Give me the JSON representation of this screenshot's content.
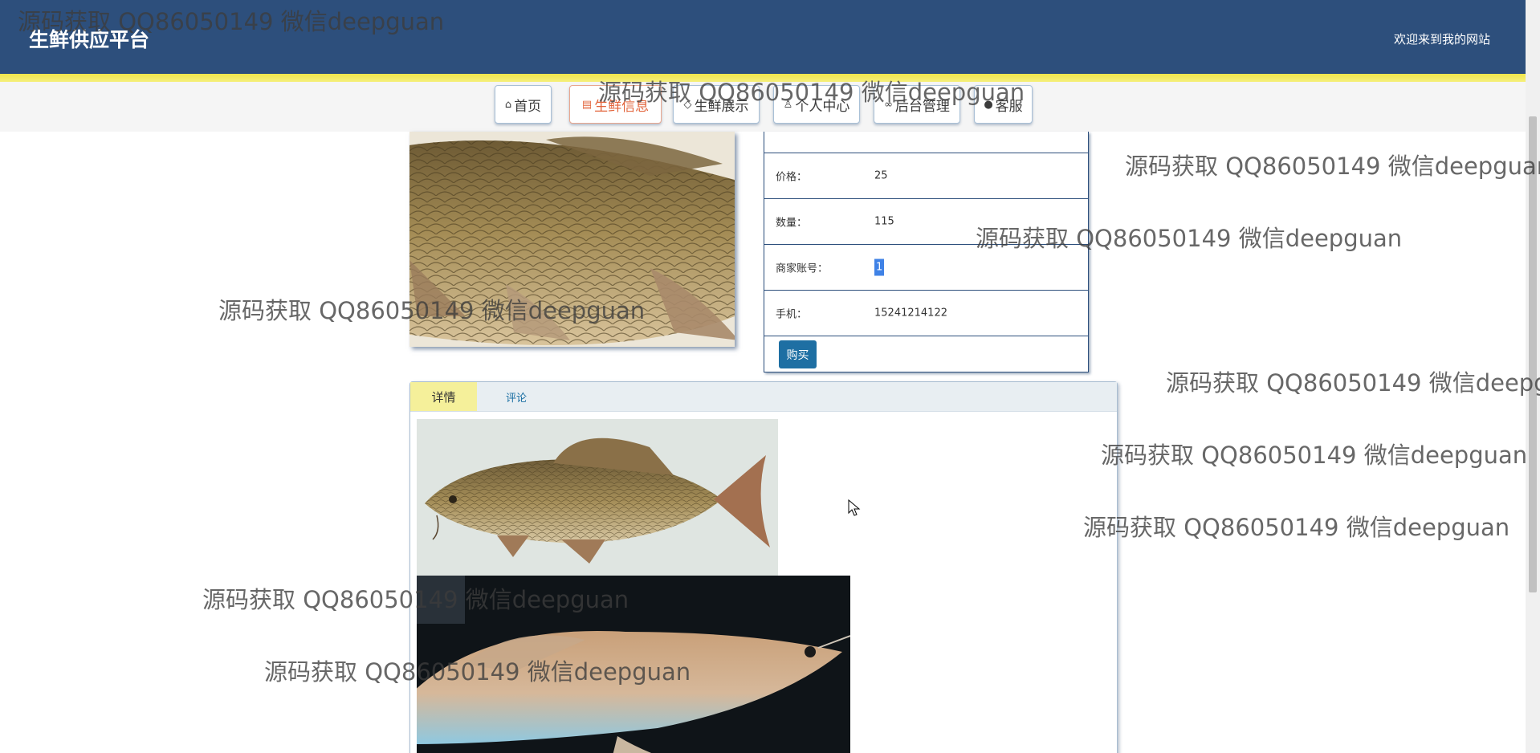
{
  "header": {
    "site_title": "生鲜供应平台",
    "welcome": "欢迎来到我的网站"
  },
  "nav": {
    "items": [
      {
        "label": "首页",
        "icon": "home-icon"
      },
      {
        "label": "生鲜信息",
        "icon": "document-icon",
        "active": true
      },
      {
        "label": "生鲜展示",
        "icon": "tag-icon"
      },
      {
        "label": "个人中心",
        "icon": "user-icon"
      },
      {
        "label": "后台管理",
        "icon": "link-icon"
      },
      {
        "label": "客服",
        "icon": "chat-icon"
      }
    ]
  },
  "info": {
    "price_label": "价格：",
    "price_value": "25",
    "quantity_label": "数量：",
    "quantity_value": "115",
    "merchant_label": "商家账号：",
    "merchant_value": "1",
    "phone_label": "手机：",
    "phone_value": "15241214122",
    "buy_label": "购买"
  },
  "tabs": {
    "detail": "详情",
    "comment": "评论"
  },
  "watermark_text": "源码获取 QQ86050149 微信deepguan",
  "colors": {
    "header_bg": "#2d4f7c",
    "accent_yellow": "#f0e64a",
    "active_nav": "#e2643b",
    "buy_button": "#1e6fa3"
  }
}
